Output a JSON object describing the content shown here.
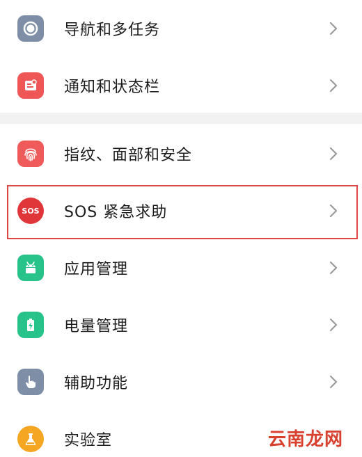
{
  "settings_items": [
    {
      "label": "导航和多任务",
      "icon": "navigation-icon",
      "color": "#7e8ea6"
    },
    {
      "label": "通知和状态栏",
      "icon": "notification-icon",
      "color": "#ef5656"
    },
    {
      "label": "指纹、面部和安全",
      "icon": "fingerprint-icon",
      "color": "#ef5a5a"
    },
    {
      "label": "SOS 紧急求助",
      "icon": "sos-icon",
      "icon_text": "SOS",
      "color": "#e0363a"
    },
    {
      "label": "应用管理",
      "icon": "android-icon",
      "color": "#27c38a"
    },
    {
      "label": "电量管理",
      "icon": "battery-icon",
      "color": "#27c38a"
    },
    {
      "label": "辅助功能",
      "icon": "hand-icon",
      "color": "#7e8ea6"
    },
    {
      "label": "实验室",
      "icon": "lab-flask-icon",
      "color": "#f5a623"
    }
  ],
  "highlight_color": "#e0463f",
  "watermark": {
    "text": "云南龙网",
    "color": "#d8412f"
  }
}
